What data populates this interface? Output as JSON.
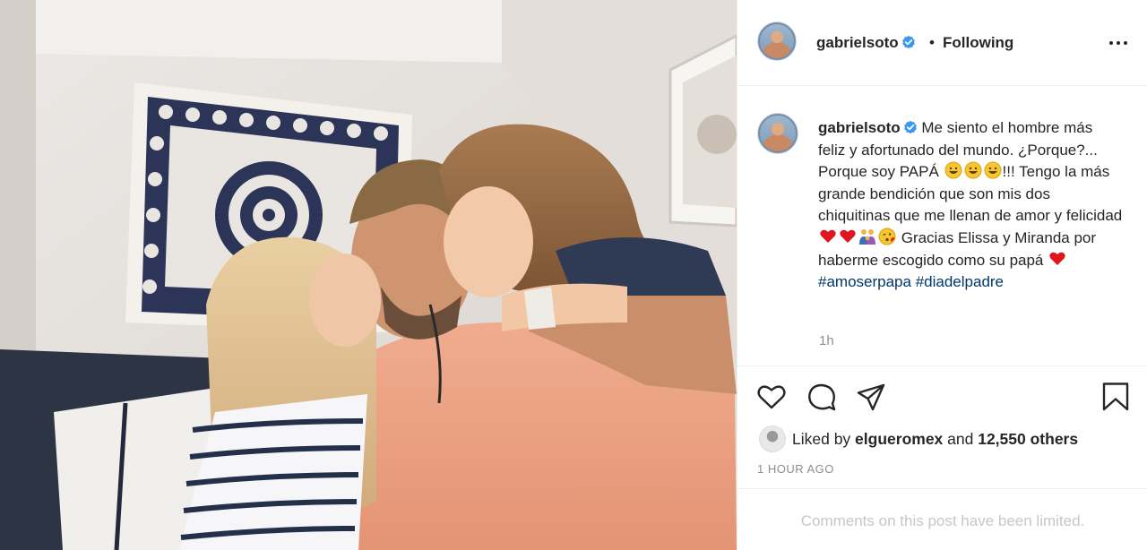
{
  "post": {
    "author": "gabrielsoto",
    "separator": "•",
    "follow_state": "Following",
    "caption": {
      "username": "gabrielsoto",
      "text_1": "Me siento el hombre más feliz y afortunado del mundo. ¿Porque?... Porque soy PAPÁ ",
      "text_2": "!!! Tengo la más grande bendición que son mis dos chiquitinas que me llenan de amor y felicidad ",
      "text_3": " Gracias Elissa y Miranda por haberme escogido como su papá ",
      "hashtag_1": "#amoserpapa",
      "hashtag_2": "#diadelpadre",
      "relative_time": "1h"
    },
    "likes": {
      "prefix": "Liked by ",
      "liker": "elgueromex",
      "middle": " and ",
      "count_text": "12,550 others"
    },
    "timestamp": "1 HOUR AGO",
    "comments_notice": "Comments on this post have been limited."
  },
  "icons": [
    "verified-badge-icon",
    "more-options-icon",
    "heart-icon",
    "comment-icon",
    "share-icon",
    "bookmark-icon",
    "grinning-emoji",
    "red-heart-emoji",
    "family-emoji",
    "kiss-emoji"
  ],
  "colors": {
    "text": "#262626",
    "muted": "#8e8e8e",
    "hashtag": "#00376b",
    "verified": "#3897f0",
    "disabled": "#c7c7c7",
    "divider": "#efefef"
  }
}
